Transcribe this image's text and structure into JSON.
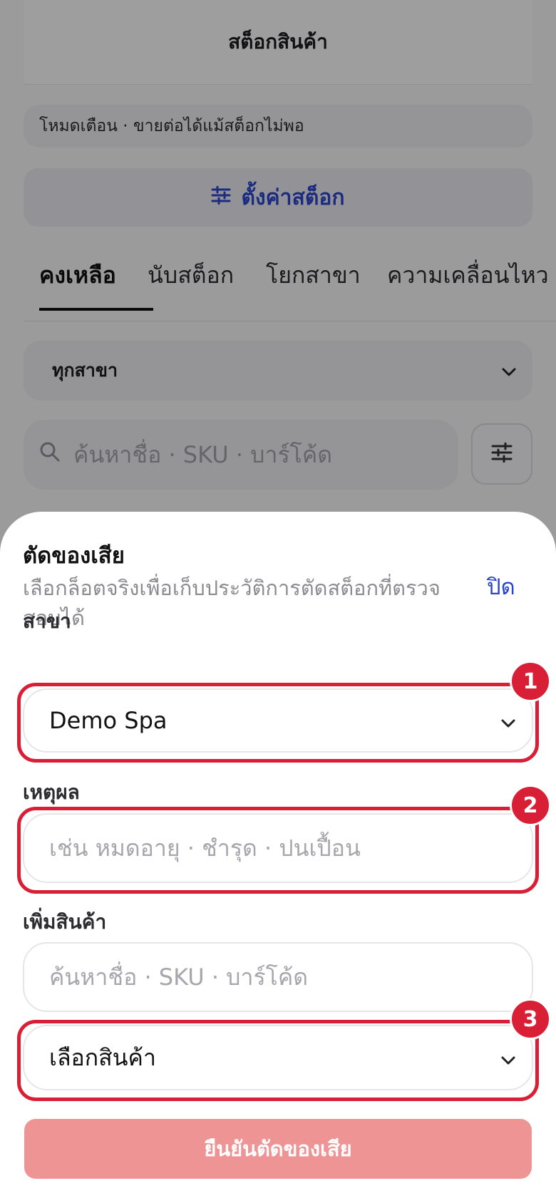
{
  "page": {
    "title": "สต็อกสินค้า",
    "mode_chip": "โหมดเตือน · ขายต่อได้แม้สต็อกไม่พอ",
    "settings_label": "ตั้งค่าสต็อก",
    "tabs": [
      {
        "label": "คงเหลือ",
        "active": true
      },
      {
        "label": "นับสต็อก",
        "active": false
      },
      {
        "label": "โยกสาขา",
        "active": false
      },
      {
        "label": "ความเคลื่อนไหว",
        "active": false
      }
    ],
    "branch_filter": "ทุกสาขา",
    "search_placeholder": "ค้นหาชื่อ · SKU · บาร์โค้ด"
  },
  "sheet": {
    "title": "ตัดของเสีย",
    "description": "เลือกล็อตจริงเพื่อเก็บประวัติการตัดสต็อกที่ตรวจสอบได้",
    "close_label": "ปิด",
    "branch_label": "สาขา",
    "branch_value": "Demo Spa",
    "reason_label": "เหตุผล",
    "reason_placeholder": "เช่น หมดอายุ · ชำรุด · ปนเปื้อน",
    "add_product_label": "เพิ่มสินค้า",
    "product_search_placeholder": "ค้นหาชื่อ · SKU · บาร์โค้ด",
    "product_select_value": "เลือกสินค้า",
    "confirm_label": "ยืนยันตัดของเสีย"
  },
  "annotations": [
    {
      "number": "1"
    },
    {
      "number": "2"
    },
    {
      "number": "3"
    }
  ],
  "colors": {
    "accent": "#2a44c8",
    "highlight": "#d81f35",
    "confirm_disabled": "#ee9494"
  }
}
